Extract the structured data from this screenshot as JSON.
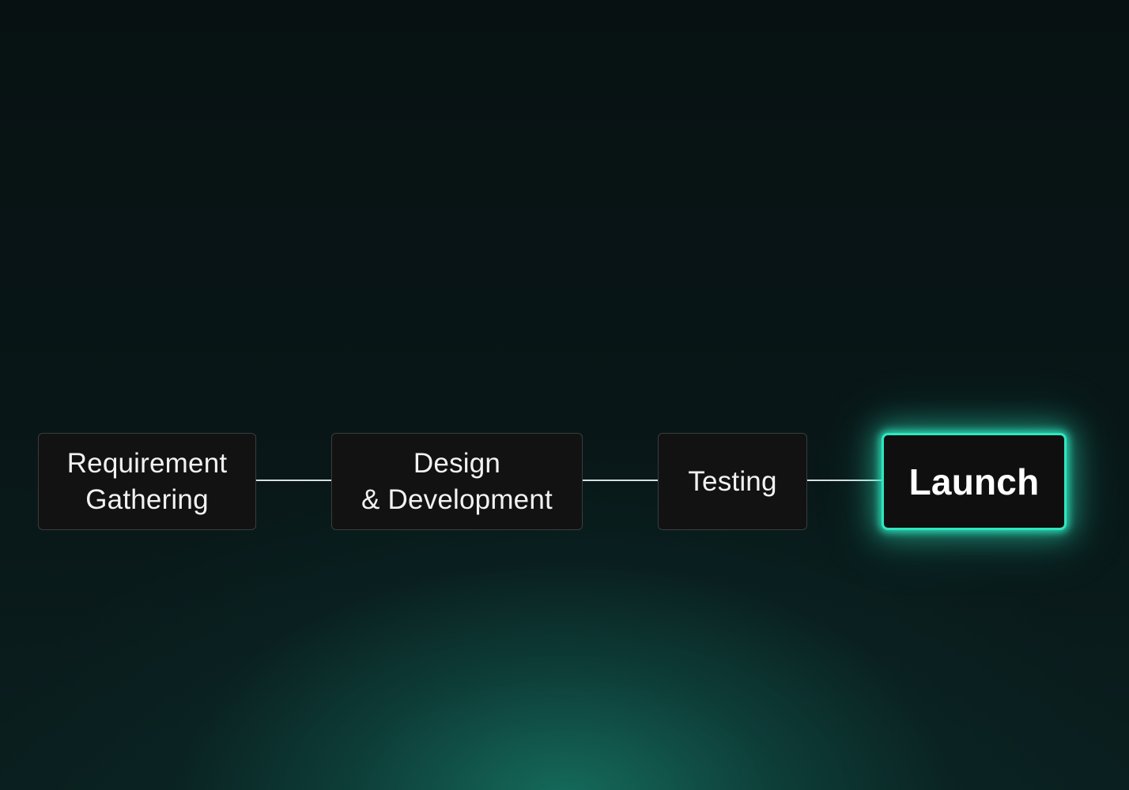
{
  "diagram": {
    "steps": [
      {
        "label": "Requirement\nGathering",
        "active": false
      },
      {
        "label": "Design\n& Development",
        "active": false
      },
      {
        "label": "Testing",
        "active": false
      },
      {
        "label": "Launch",
        "active": true
      }
    ],
    "colors": {
      "background": "#081315",
      "node_fill": "#121212",
      "connector": "#d9dede",
      "active_glow": "#2fe6bf"
    }
  }
}
